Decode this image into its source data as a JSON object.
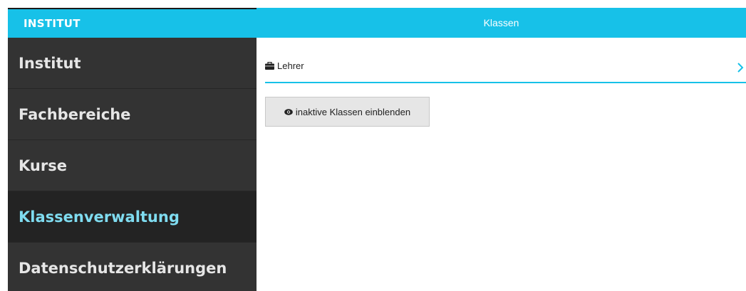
{
  "header": {
    "brand": "INSTITUT",
    "title": "Klassen"
  },
  "sidebar": {
    "items": [
      {
        "label": "Institut",
        "active": false
      },
      {
        "label": "Fachbereiche",
        "active": false
      },
      {
        "label": "Kurse",
        "active": false
      },
      {
        "label": "Klassenverwaltung",
        "active": true
      },
      {
        "label": "Datenschutzerklärungen",
        "active": false
      }
    ]
  },
  "main": {
    "row": {
      "label": "Lehrer",
      "icon": "briefcase-icon",
      "action_icon": "chevron-right-icon"
    },
    "button": {
      "label": "inaktive Klassen einblenden",
      "icon": "eye-icon"
    }
  },
  "colors": {
    "accent": "#17c1e8",
    "sidebar_bg": "#333333",
    "sidebar_active_bg": "#232323",
    "sidebar_active_text": "#7fdcf0",
    "button_bg": "#e6e6e6"
  }
}
